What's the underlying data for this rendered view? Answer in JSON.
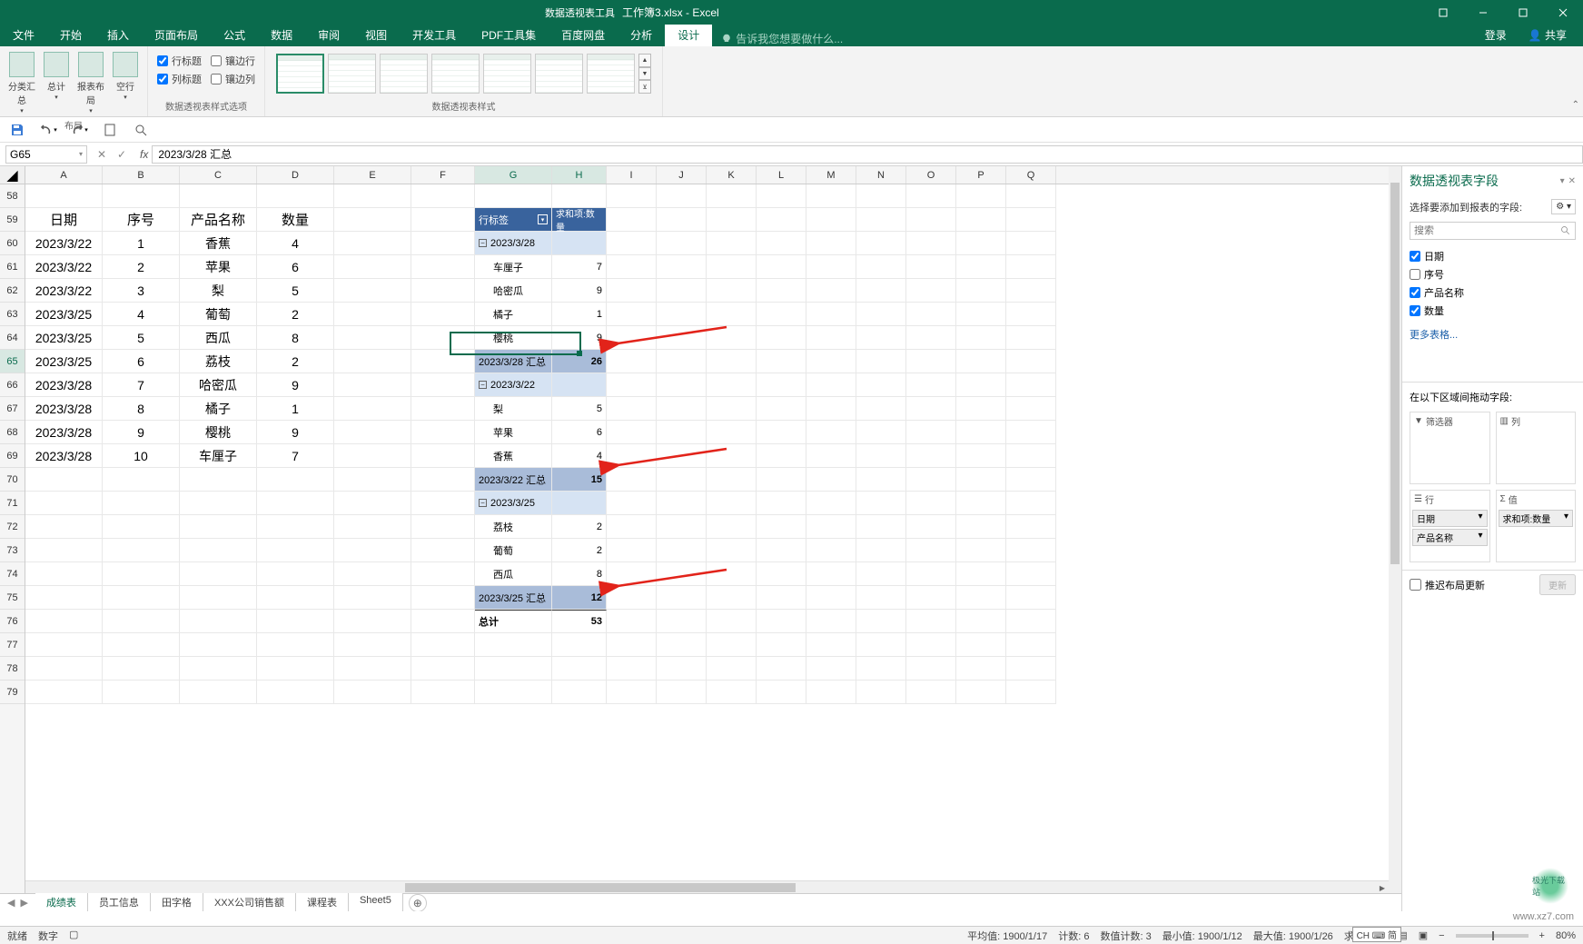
{
  "window": {
    "context": "数据透视表工具",
    "title": "工作簿3.xlsx - Excel",
    "login": "登录",
    "share": "共享"
  },
  "ribbonTabs": [
    "文件",
    "开始",
    "插入",
    "页面布局",
    "公式",
    "数据",
    "审阅",
    "视图",
    "开发工具",
    "PDF工具集",
    "百度网盘",
    "分析",
    "设计"
  ],
  "tellMe": "告诉我您想要做什么...",
  "ribbon": {
    "layoutGroup": "布局",
    "btn1": "分类汇总",
    "btn2": "总计",
    "btn3": "报表布局",
    "btn4": "空行",
    "styleOptionsGroup": "数据透视表样式选项",
    "stylesGroup": "数据透视表样式",
    "cb1": "行标题",
    "cb2": "镶边行",
    "cb3": "列标题",
    "cb4": "镶边列"
  },
  "nameBox": "G65",
  "formula": "2023/3/28 汇总",
  "columns": [
    "A",
    "B",
    "C",
    "D",
    "E",
    "F",
    "G",
    "H",
    "I",
    "J",
    "K",
    "L",
    "M",
    "N",
    "O",
    "P",
    "Q"
  ],
  "rowStart": 58,
  "rowEnd": 79,
  "dataTable": {
    "headers": [
      "日期",
      "序号",
      "产品名称",
      "数量"
    ],
    "rows": [
      [
        "2023/3/22",
        "1",
        "香蕉",
        "4"
      ],
      [
        "2023/3/22",
        "2",
        "苹果",
        "6"
      ],
      [
        "2023/3/22",
        "3",
        "梨",
        "5"
      ],
      [
        "2023/3/25",
        "4",
        "葡萄",
        "2"
      ],
      [
        "2023/3/25",
        "5",
        "西瓜",
        "8"
      ],
      [
        "2023/3/25",
        "6",
        "荔枝",
        "2"
      ],
      [
        "2023/3/28",
        "7",
        "哈密瓜",
        "9"
      ],
      [
        "2023/3/28",
        "8",
        "橘子",
        "1"
      ],
      [
        "2023/3/28",
        "9",
        "樱桃",
        "9"
      ],
      [
        "2023/3/28",
        "10",
        "车厘子",
        "7"
      ]
    ]
  },
  "pivot": {
    "rowLabel": "行标签",
    "valLabel": "求和项:数量",
    "groups": [
      {
        "name": "2023/3/28",
        "items": [
          {
            "n": "车厘子",
            "v": "7"
          },
          {
            "n": "哈密瓜",
            "v": "9"
          },
          {
            "n": "橘子",
            "v": "1"
          },
          {
            "n": "樱桃",
            "v": "9"
          }
        ],
        "subName": "2023/3/28 汇总",
        "subVal": "26"
      },
      {
        "name": "2023/3/22",
        "items": [
          {
            "n": "梨",
            "v": "5"
          },
          {
            "n": "苹果",
            "v": "6"
          },
          {
            "n": "香蕉",
            "v": "4"
          }
        ],
        "subName": "2023/3/22 汇总",
        "subVal": "15"
      },
      {
        "name": "2023/3/25",
        "items": [
          {
            "n": "荔枝",
            "v": "2"
          },
          {
            "n": "葡萄",
            "v": "2"
          },
          {
            "n": "西瓜",
            "v": "8"
          }
        ],
        "subName": "2023/3/25 汇总",
        "subVal": "12"
      }
    ],
    "grandLabel": "总计",
    "grandVal": "53"
  },
  "sheetTabs": [
    "成绩表",
    "员工信息",
    "田字格",
    "XXX公司销售额",
    "课程表",
    "Sheet5"
  ],
  "sheetActive": 0,
  "taskPane": {
    "title": "数据透视表字段",
    "subtitle": "选择要添加到报表的字段:",
    "searchPlaceholder": "搜索",
    "fields": [
      {
        "label": "日期",
        "checked": true
      },
      {
        "label": "序号",
        "checked": false
      },
      {
        "label": "产品名称",
        "checked": true
      },
      {
        "label": "数量",
        "checked": true
      }
    ],
    "moreTables": "更多表格...",
    "areasLabel": "在以下区域间拖动字段:",
    "areas": {
      "filters": {
        "label": "筛选器",
        "items": []
      },
      "columns": {
        "label": "列",
        "items": []
      },
      "rows": {
        "label": "行",
        "items": [
          "日期",
          "产品名称"
        ]
      },
      "values": {
        "label": "值",
        "items": [
          "求和项:数量"
        ]
      }
    },
    "deferLabel": "推迟布局更新",
    "updateBtn": "更新"
  },
  "status": {
    "ready": "就绪",
    "numlock": "数字",
    "avg": "平均值: 1900/1/17",
    "count": "计数: 6",
    "numcount": "数值计数: 3",
    "min": "最小值: 1900/1/12",
    "max": "最大值: 1900/1/26",
    "sum": "求和:",
    "zoom": "80%",
    "ime": "CH ⌨ 简"
  },
  "watermark": "www.xz7.com",
  "wm_brand": "极光下载站"
}
